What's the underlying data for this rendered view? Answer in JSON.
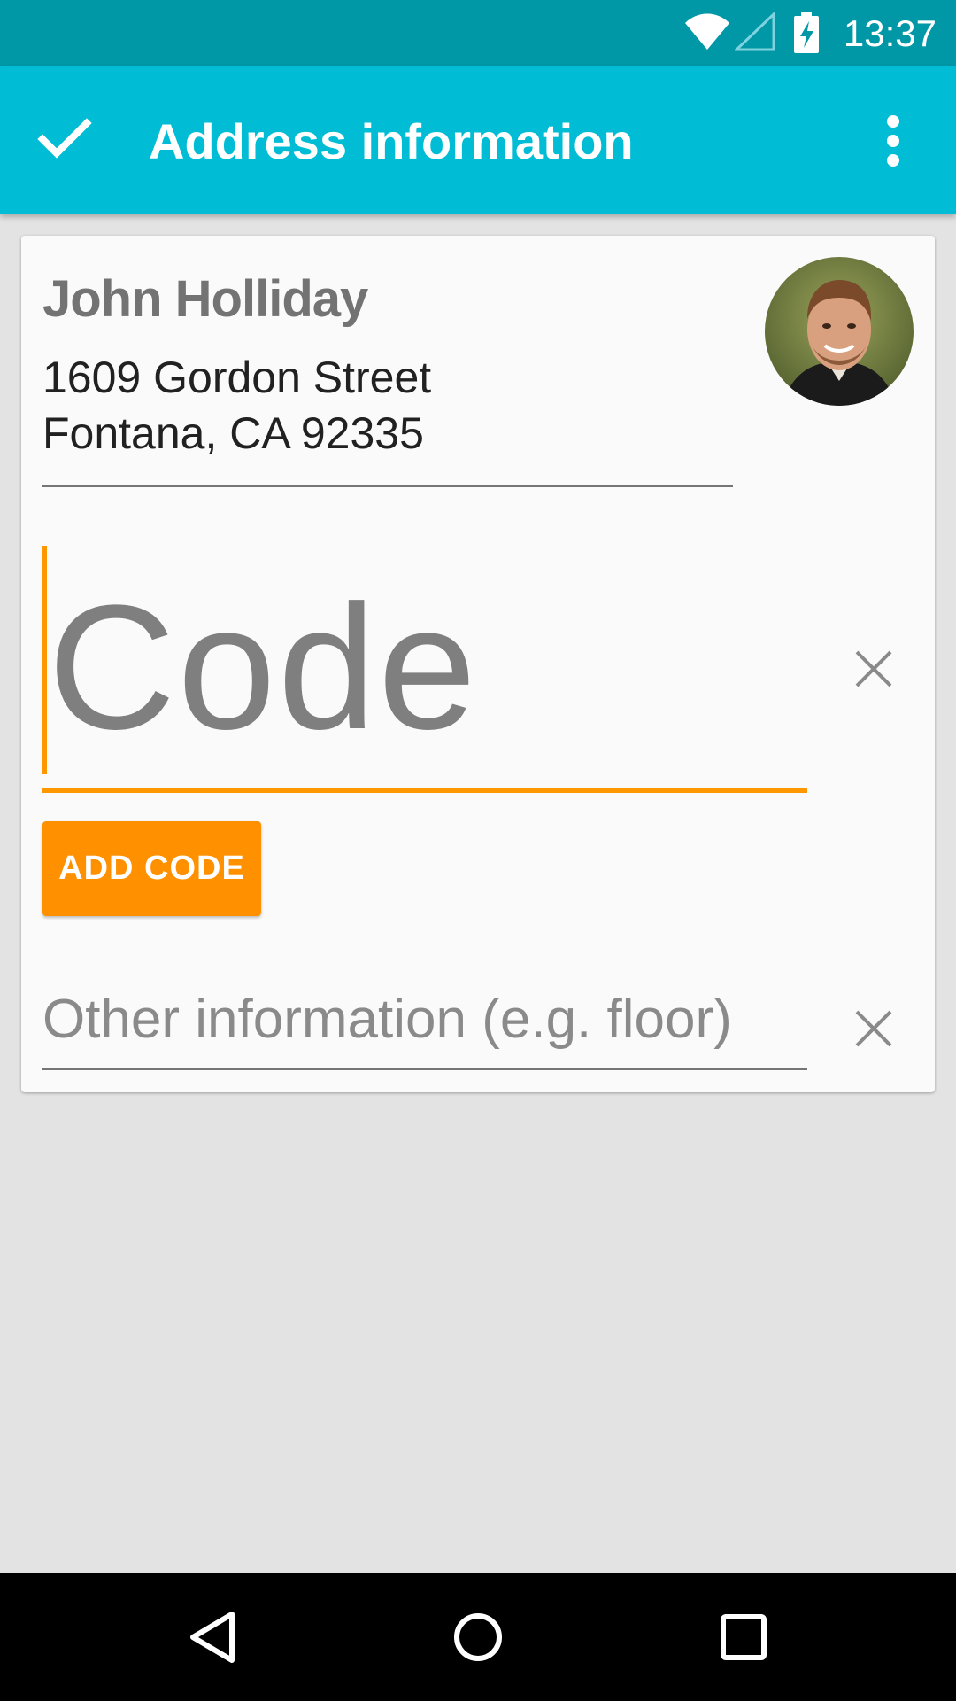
{
  "status_bar": {
    "time": "13:37",
    "icons": [
      "wifi-icon",
      "signal-icon",
      "battery-charging-icon"
    ]
  },
  "app_bar": {
    "title": "Address information",
    "left_icon": "check-icon",
    "right_icon": "more-vert-icon",
    "color": "#00bcd4"
  },
  "contact": {
    "name": "John Holliday",
    "address_line1": "1609 Gordon Street",
    "address_line2": "Fontana, CA 92335",
    "avatar": "avatar-photo"
  },
  "code_field": {
    "value": "",
    "placeholder": "Code",
    "accent_color": "#ff9800"
  },
  "add_code_button": {
    "label": "ADD CODE",
    "color": "#ff9100"
  },
  "other_field": {
    "value": "",
    "placeholder": "Other information (e.g. floor)"
  },
  "nav_bar": {
    "icons": [
      "back-icon",
      "home-icon",
      "recents-icon"
    ]
  }
}
